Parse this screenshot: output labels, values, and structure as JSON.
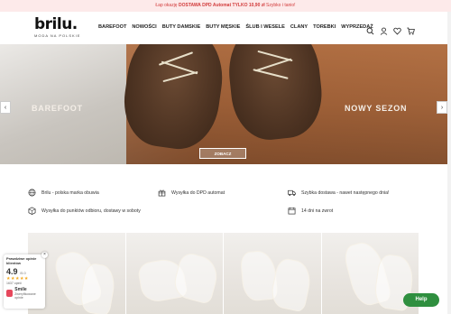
{
  "promo": {
    "prefix": "Łap okazję",
    "highlight": "DOSTAWA DPD Automat TYLKO 10,90 zł",
    "suffix": "Szybko i tanio!"
  },
  "header": {
    "logo_word": "brilu.",
    "logo_sub": "MODA NA POLSKIE",
    "nav": [
      "BAREFOOT",
      "NOWOŚCI",
      "BUTY DAMSKIE",
      "BUTY MĘSKIE",
      "ŚLUB I WESELE",
      "CLANY",
      "TOREBKI",
      "WYPRZEDAŻ"
    ],
    "icons": [
      "search-icon",
      "user-icon",
      "heart-icon",
      "cart-icon"
    ]
  },
  "hero": {
    "left_label": "BAREFOOT",
    "right_label": "NOWY SEZON",
    "button": "ZOBACZ",
    "prev": "‹",
    "next": "›"
  },
  "features": [
    {
      "icon": "globe-icon",
      "text": "Brilu - polska marka obuwia"
    },
    {
      "icon": "gift-icon",
      "text": "Wysyłka do DPD automat"
    },
    {
      "icon": "truck-icon",
      "text": "Szybka dostawa - nawet następnego dnia!"
    },
    {
      "icon": "box-icon",
      "text": "Wysyłka do punktów odbioru, dostawy w soboty"
    },
    {
      "icon": "return-icon",
      "text": "14 dni na zwrot"
    }
  ],
  "opinions": {
    "title": "Prawdziwe opinie klientów",
    "score": "4.9",
    "scale": "/5.0",
    "stars": "★★★★★",
    "count": "1637 opinii",
    "brand": "Smile",
    "brand_sub": "Zweryfikowane opinie",
    "close": "×"
  },
  "help": {
    "label": "Help"
  },
  "colors": {
    "promo_bg": "#fdeaea",
    "promo_text": "#d23b3b",
    "help_bg": "#2f8f3f"
  }
}
